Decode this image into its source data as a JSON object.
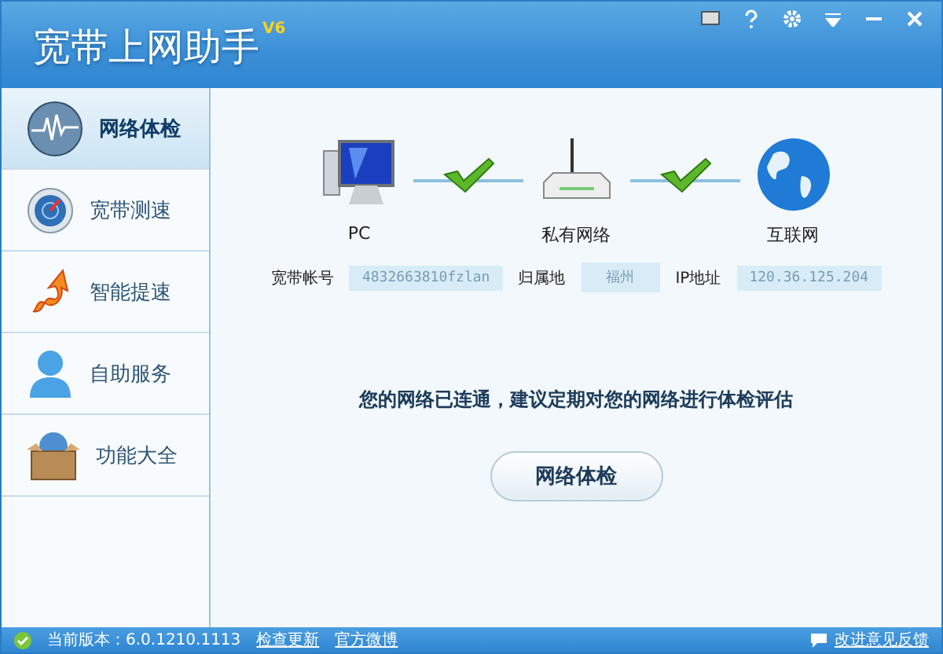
{
  "window": {
    "title": "宽带上网助手",
    "version": "V6"
  },
  "sidebar": {
    "items": [
      {
        "label": "网络体检",
        "kind": "checkup",
        "selected": true
      },
      {
        "label": "宽带测速",
        "kind": "speed",
        "selected": false
      },
      {
        "label": "智能提速",
        "kind": "boost",
        "selected": false
      },
      {
        "label": "自助服务",
        "kind": "service",
        "selected": false
      },
      {
        "label": "功能大全",
        "kind": "toolbox",
        "selected": false
      }
    ]
  },
  "diagram": {
    "nodes": [
      {
        "label": "PC",
        "kind": "pc"
      },
      {
        "label": "私有网络",
        "kind": "router"
      },
      {
        "label": "互联网",
        "kind": "globe"
      }
    ],
    "links": [
      {
        "ok": true
      },
      {
        "ok": true
      }
    ]
  },
  "info": [
    {
      "label": "宽带帐号",
      "value": "4832663810fzlan"
    },
    {
      "label": "归属地",
      "value": "福州"
    },
    {
      "label": "IP地址",
      "value": "120.36.125.204"
    }
  ],
  "message": "您的网络已连通，建议定期对您的网络进行体检评估",
  "action_button": "网络体检",
  "status_bar": {
    "version": "当前版本：6.0.1210.1113",
    "links": [
      "检查更新",
      "官方微博"
    ],
    "feedback": "改进意见反馈"
  }
}
